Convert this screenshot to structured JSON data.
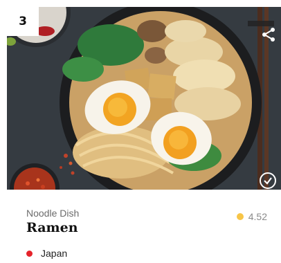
{
  "card": {
    "rank": "3",
    "category": "Noodle Dish",
    "title": "Ramen",
    "rating": "4.52",
    "origin": "Japan"
  },
  "icons": {
    "share": "share-icon",
    "check": "check-circle-icon",
    "star": "star-icon",
    "origin_marker": "red-dot-icon"
  },
  "colors": {
    "rating_star": "#f7c548",
    "origin_marker": "#e5232b"
  }
}
